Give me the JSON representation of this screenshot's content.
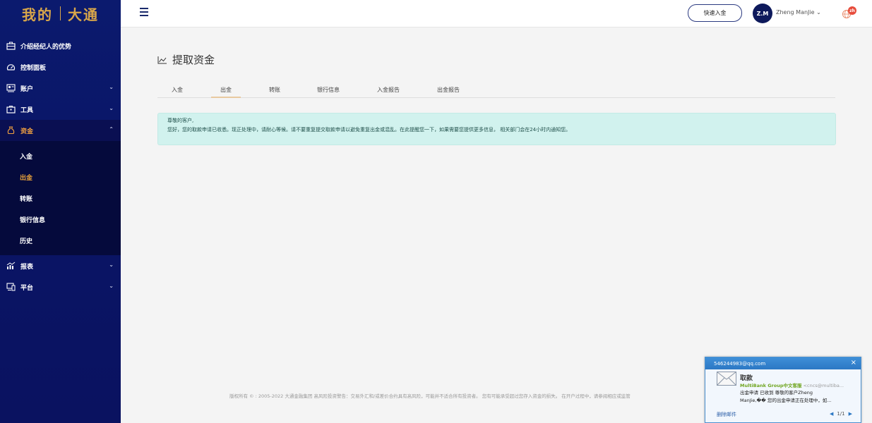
{
  "brand": {
    "left": "我的",
    "right": "大通"
  },
  "sidebar": {
    "items": [
      {
        "label": "介绍经纪人的优势",
        "icon": "briefcase-icon"
      },
      {
        "label": "控制面板",
        "icon": "dashboard-gauge-icon"
      },
      {
        "label": "账户",
        "icon": "account-icon"
      },
      {
        "label": "工具",
        "icon": "toolbox-icon"
      },
      {
        "label": "资金",
        "icon": "money-bag-icon"
      },
      {
        "label": "报表",
        "icon": "bar-chart-icon"
      },
      {
        "label": "平台",
        "icon": "devices-icon"
      }
    ],
    "submenu": [
      "入金",
      "出金",
      "转账",
      "银行信息",
      "历史"
    ]
  },
  "header": {
    "deposit_button": "快速入金",
    "avatar_initials": "Z.M",
    "username": "Zheng ManJie",
    "lang_badge": "zh"
  },
  "page": {
    "title": "提取资金",
    "tabs": [
      "入金",
      "出金",
      "转账",
      "银行信息",
      "入金报告",
      "出金报告"
    ],
    "notice": {
      "greeting": "尊敬的客户,",
      "message": "您好，您的取款申请已收悉。现正处理中，请耐心等候。请不要重复提交取款申请以避免重复出金或混乱。在此提醒您一下，如果需要您提供更多信息， 相关部门会在24小时内通知您。"
    },
    "footer": "版权所有 © : 2005-2022 大通金融集团 高风险投资警告：交易外汇和/或差价合约具有高风险，可能并不适合所有投资者。 您有可能承受超过您存入资金的损失。 在开户过程中，请参阅相应或监管"
  },
  "notification": {
    "account": "546244983@qq.com",
    "subject": "取款",
    "sender_name": "MultiBank Group中文客服",
    "sender_addr": "<cncs@multiba...",
    "body_line1": "出金申请 已收到    尊敬的客户Zheng",
    "body_line2": "ManJie,��     您的出金申请正在处理中，如...",
    "delete_label": "删除邮件",
    "pager": "1/1"
  },
  "colors": {
    "sidebar": "#0b1a6e",
    "accent": "#e8a23a",
    "notice_bg": "#d1f2ee",
    "logo": "#d8a64a"
  }
}
